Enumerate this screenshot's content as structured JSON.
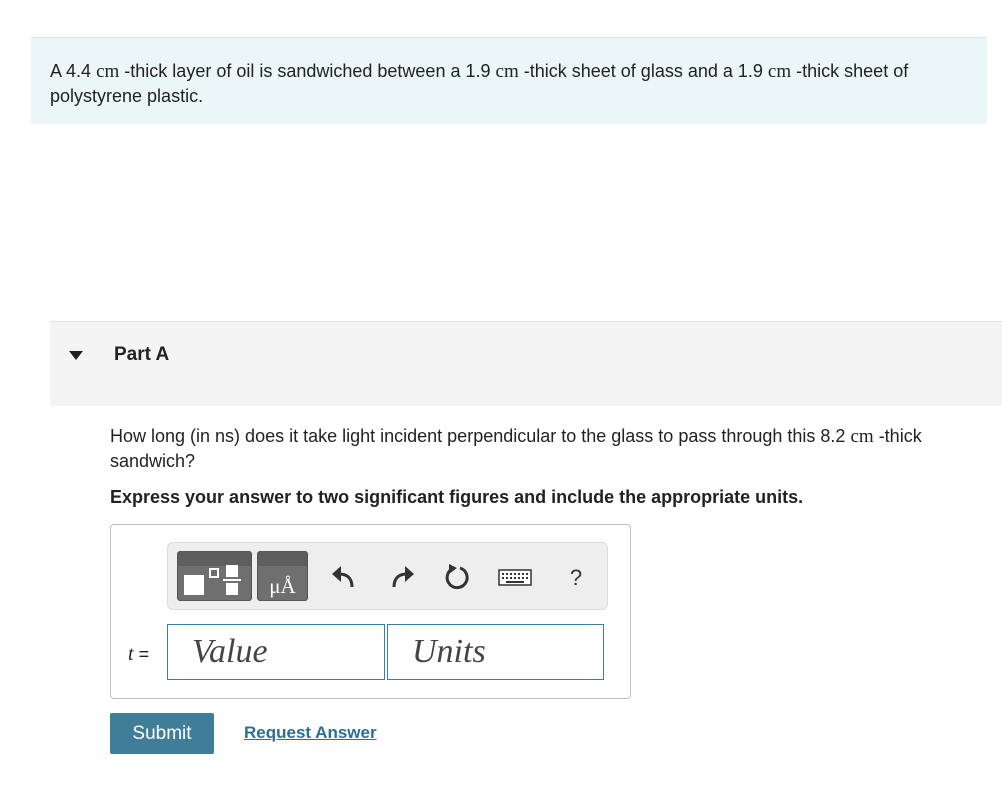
{
  "problem": {
    "prefix": "A 4.4",
    "unit1": "cm",
    "mid1": "-thick layer of oil is sandwiched between a 1.9",
    "unit2": "cm",
    "mid2": "-thick sheet of glass and a 1.9",
    "unit3": "cm",
    "suffix": "-thick sheet of polystyrene plastic."
  },
  "part": {
    "title": "Part A"
  },
  "question": {
    "prefix": "How long (in ns) does it take light incident perpendicular to the glass to pass through this 8.2",
    "unit": "cm",
    "suffix": "-thick sandwich?"
  },
  "instruction": "Express your answer to two significant figures and include the appropriate units.",
  "answer": {
    "variable": "t",
    "equals": "=",
    "value_placeholder": "Value",
    "units_placeholder": "Units",
    "value": "",
    "units": ""
  },
  "toolbar": {
    "symbols_label": "μÅ",
    "help_label": "?",
    "icons": [
      "templates-icon",
      "symbols-icon",
      "undo-icon",
      "redo-icon",
      "reset-icon",
      "keyboard-icon",
      "help-icon"
    ]
  },
  "buttons": {
    "submit": "Submit",
    "request_answer": "Request Answer"
  },
  "colors": {
    "problem_bg": "#eaf6f8",
    "part_header_bg": "#f4f4f4",
    "submit_bg": "#3f7d99",
    "link": "#2b6f95",
    "input_border": "#3a7ea1"
  }
}
